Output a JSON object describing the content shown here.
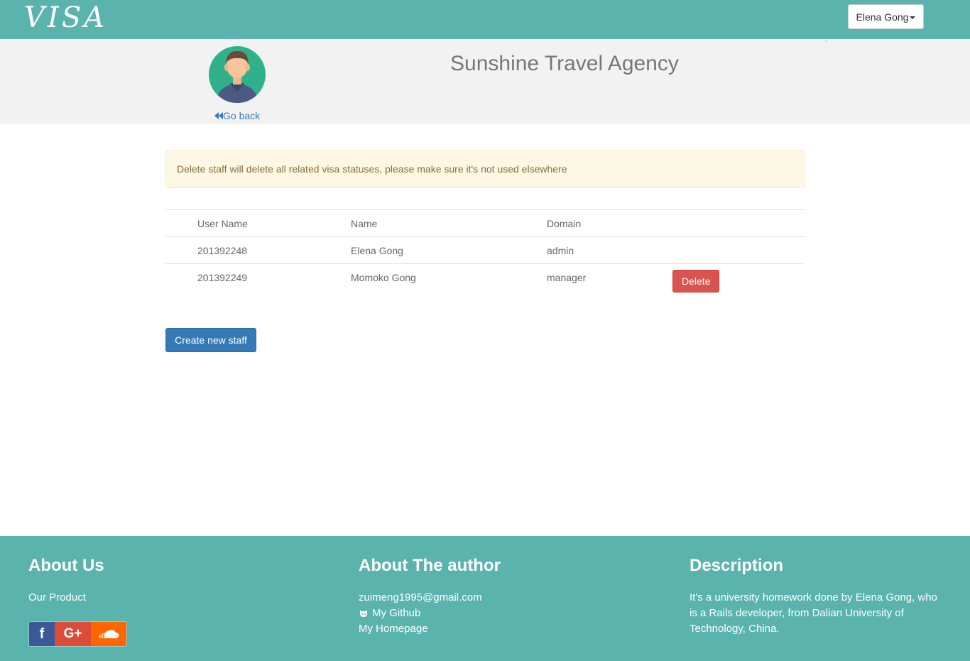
{
  "nav": {
    "logo": "VISA",
    "user_menu": "Elena Gong"
  },
  "header": {
    "go_back": "Go back",
    "agency_name": "Sunshine Travel Agency",
    "tick": "`"
  },
  "alert": {
    "message": "Delete staff will delete all related visa statuses, please make sure it's not used elsewhere"
  },
  "table": {
    "headers": [
      "User Name",
      "Name",
      "Domain"
    ],
    "rows": [
      {
        "username": "201392248",
        "name": "Elena Gong",
        "domain": "admin"
      },
      {
        "username": "201392249",
        "name": "Momoko Gong",
        "domain": "manager",
        "action": "Delete"
      }
    ]
  },
  "create_button": "Create new staff",
  "footer": {
    "about_us": {
      "title": "About Us",
      "link": "Our Product"
    },
    "about_author": {
      "title": "About The author",
      "email": "zuimeng1995@gmail.com",
      "github": "My Github",
      "homepage": "My Homepage"
    },
    "description": {
      "title": "Description",
      "text": "It's a university homework done by Elena Gong, who is a Rails developer, from Dalian University of Technology, China."
    },
    "social_icons": [
      "facebook-icon",
      "google-plus-icon",
      "soundcloud-icon"
    ]
  },
  "colors": {
    "teal": "#5bb3ae",
    "primary": "#337ab7",
    "danger": "#d9534f",
    "avatar_bg": "#2fb18c"
  }
}
